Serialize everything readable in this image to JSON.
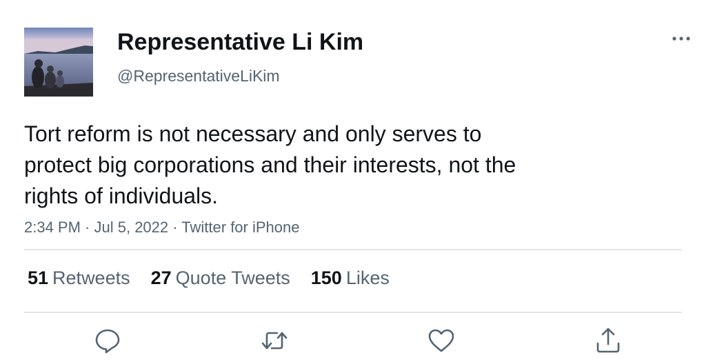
{
  "author": {
    "name": "Representative Li Kim",
    "handle": "@RepresentativeLiKim"
  },
  "tweet": {
    "lines": [
      "Tort reform is not necessary and only serves to",
      "protect big corporations and their interests, not the",
      "rights of individuals."
    ],
    "time": "2:34 PM",
    "date": "Jul 5, 2022",
    "source": "Twitter for iPhone",
    "separator": " · "
  },
  "stats": {
    "retweets": {
      "count": "51",
      "label": "Retweets"
    },
    "quotes": {
      "count": "27",
      "label": "Quote Tweets"
    },
    "likes": {
      "count": "150",
      "label": "Likes"
    }
  },
  "icons": {
    "more": "more-horizontal-icon",
    "reply": "reply-icon",
    "retweet": "retweet-icon",
    "like": "heart-icon",
    "share": "share-icon"
  },
  "colors": {
    "text": "#0f1419",
    "secondary": "#536471",
    "divider": "#e1e6ea"
  }
}
